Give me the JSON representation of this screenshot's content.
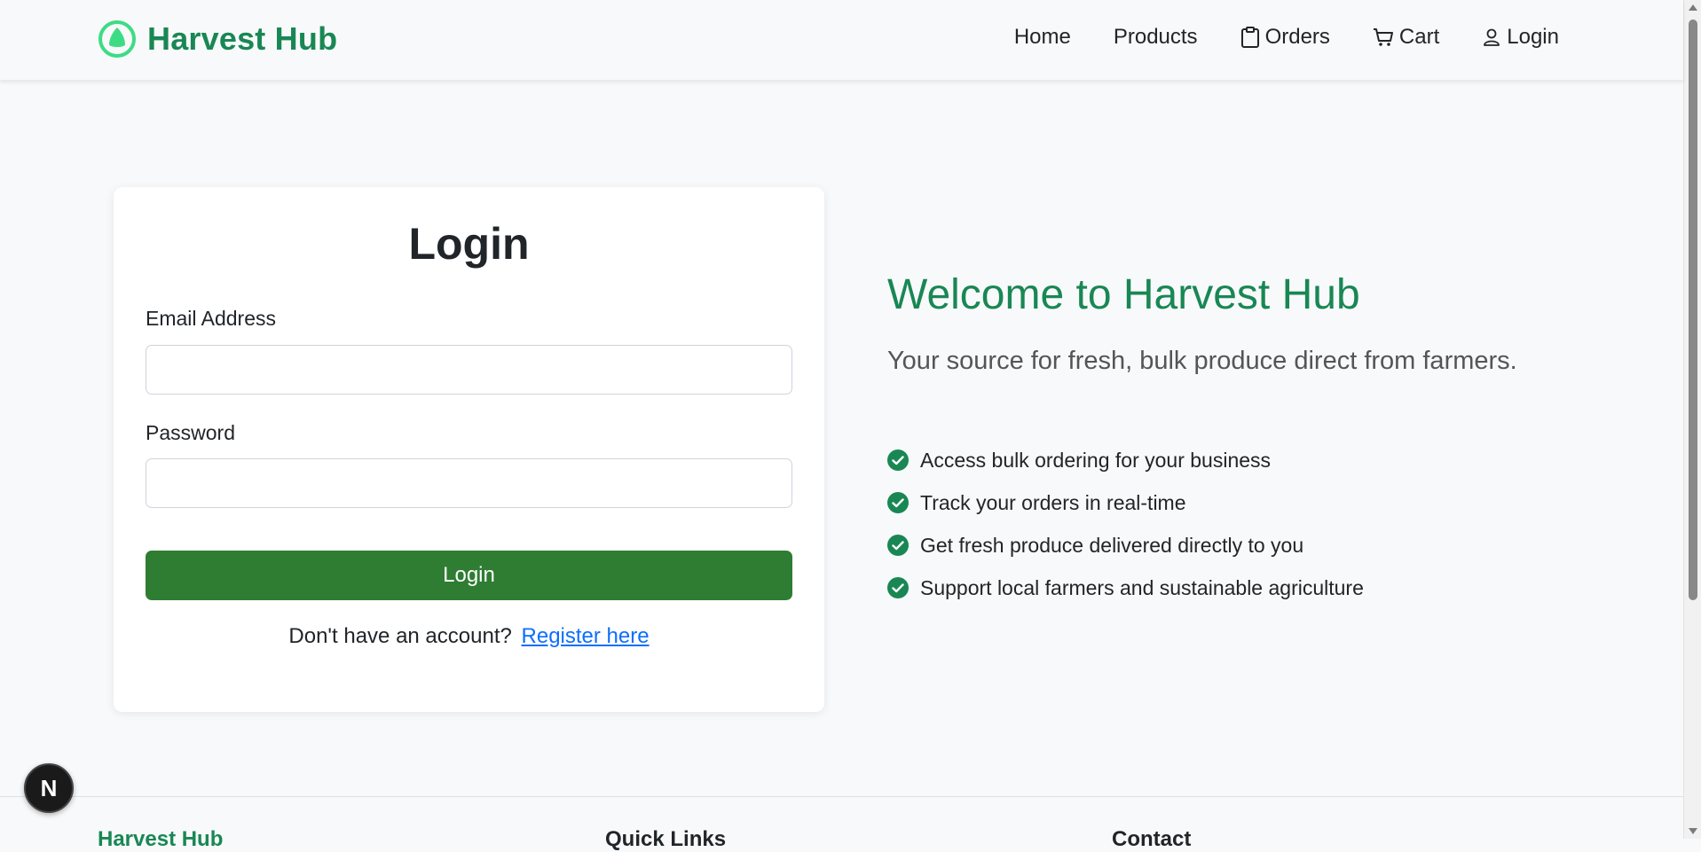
{
  "brand": {
    "name": "Harvest Hub",
    "icon": "leaf-icon",
    "color": "#198754"
  },
  "nav": {
    "home": "Home",
    "products": "Products",
    "orders": "Orders",
    "cart": "Cart",
    "login": "Login"
  },
  "login_card": {
    "title": "Login",
    "email_label": "Email Address",
    "email_value": "",
    "password_label": "Password",
    "password_value": "",
    "submit_label": "Login",
    "submit_color": "#2e7d32",
    "no_account_text": "Don't have an account?",
    "register_link": "Register here"
  },
  "welcome": {
    "title": "Welcome to Harvest Hub",
    "subtitle": "Your source for fresh, bulk produce direct from farmers.",
    "features": [
      "Access bulk ordering for your business",
      "Track your orders in real-time",
      "Get fresh produce delivered directly to you",
      "Support local farmers and sustainable agriculture"
    ]
  },
  "footer": {
    "col1": "Harvest Hub",
    "col2": "Quick Links",
    "col3": "Contact"
  },
  "badge": {
    "letter": "N"
  }
}
